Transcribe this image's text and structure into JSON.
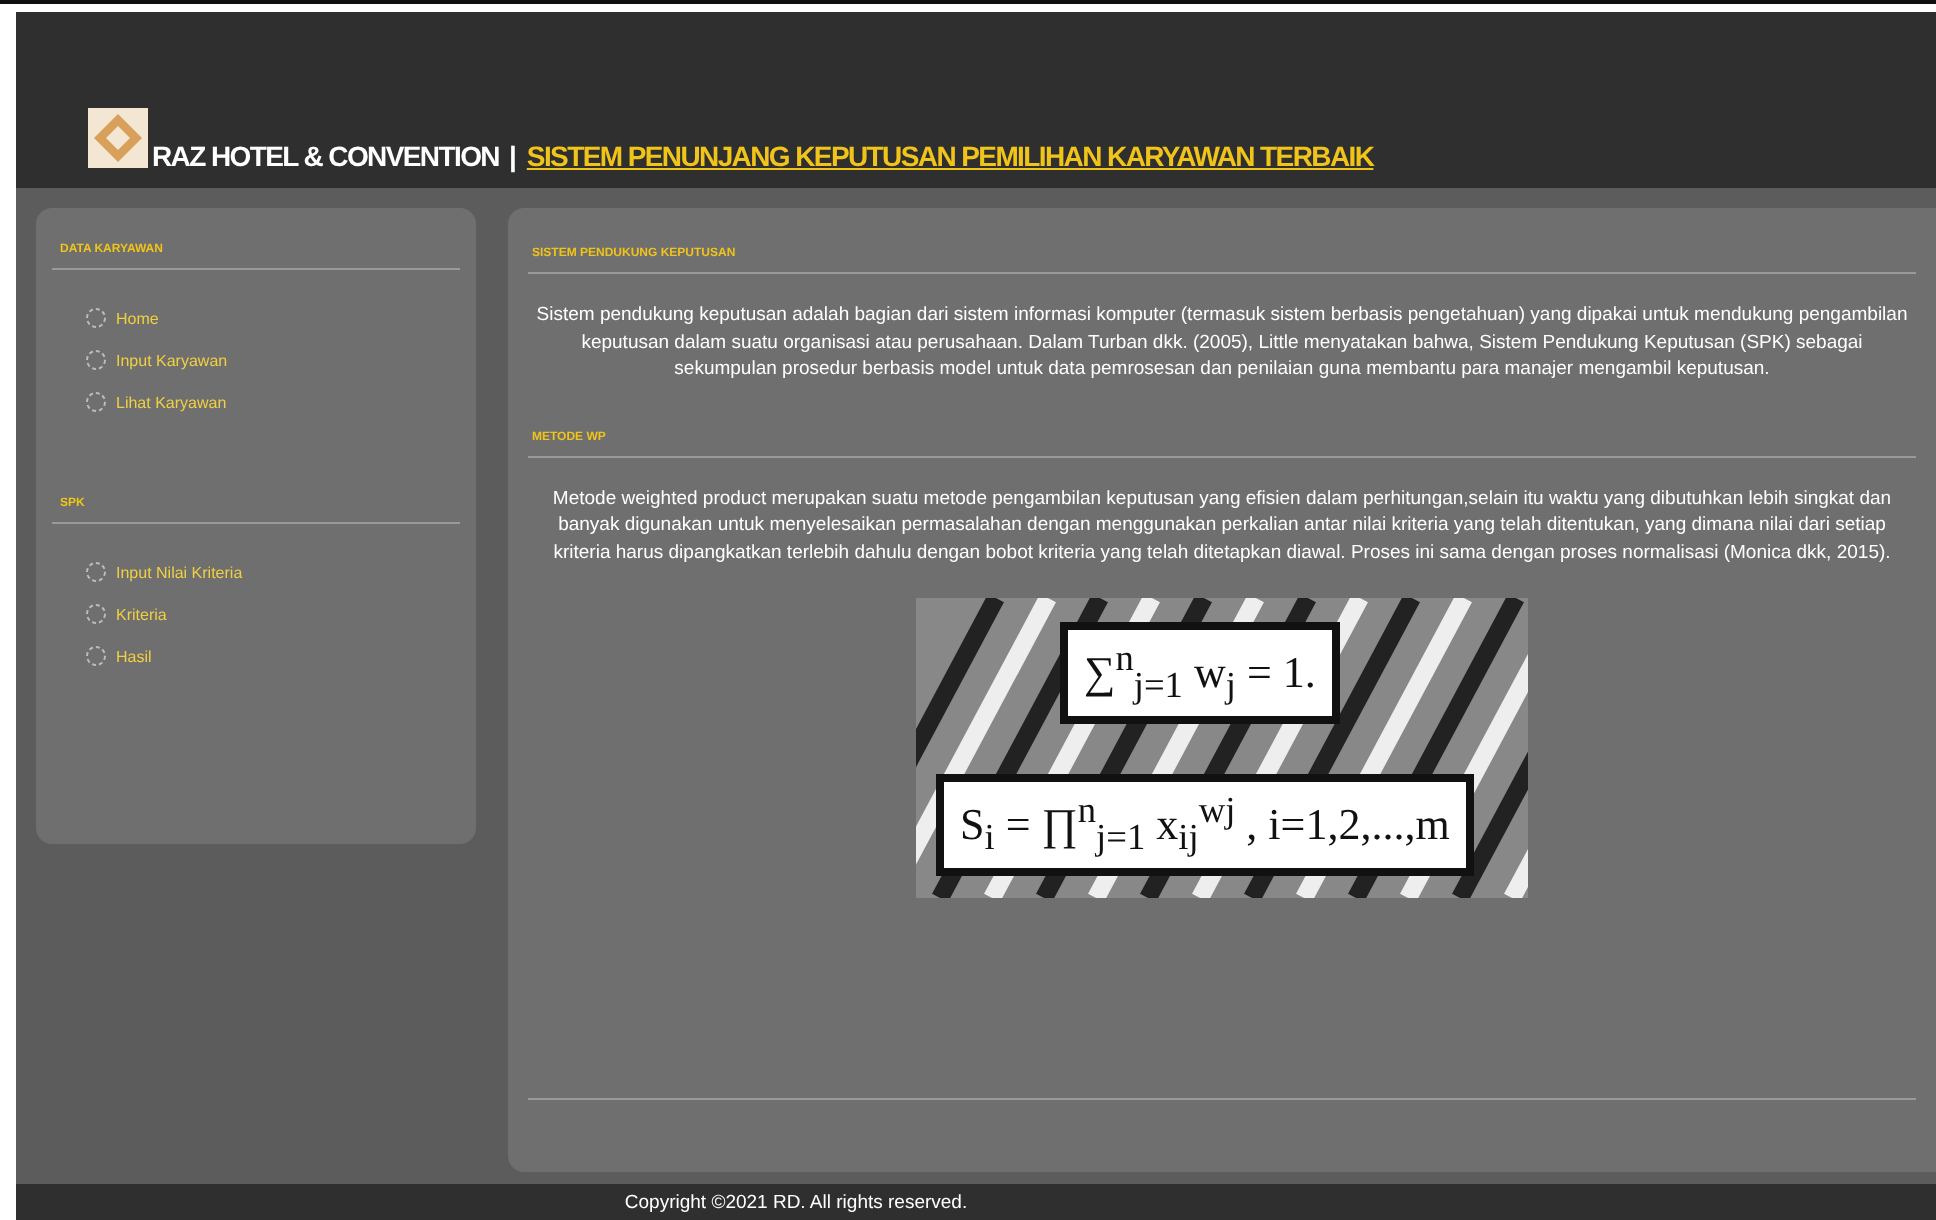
{
  "header": {
    "brand": "RAZ HOTEL & CONVENTION",
    "separator": "|",
    "title": "SISTEM PENUNJANG KEPUTUSAN PEMILIHAN KARYAWAN TERBAIK"
  },
  "sidebar": {
    "sections": [
      {
        "heading": "DATA KARYAWAN",
        "items": [
          {
            "label": "Home"
          },
          {
            "label": "Input Karyawan"
          },
          {
            "label": "Lihat Karyawan"
          }
        ]
      },
      {
        "heading": "SPK",
        "items": [
          {
            "label": "Input Nilai Kriteria"
          },
          {
            "label": "Kriteria"
          },
          {
            "label": "Hasil"
          }
        ]
      }
    ]
  },
  "content": {
    "sections": [
      {
        "heading": "SISTEM PENDUKUNG KEPUTUSAN",
        "text": "Sistem pendukung keputusan adalah bagian dari sistem informasi komputer (termasuk sistem berbasis pengetahuan) yang dipakai untuk mendukung pengambilan keputusan dalam suatu organisasi atau perusahaan. Dalam Turban dkk. (2005), Little menyatakan bahwa, Sistem Pendukung Keputusan (SPK) sebagai sekumpulan prosedur berbasis model untuk data pemrosesan dan penilaian guna membantu para manajer mengambil keputusan."
      },
      {
        "heading": "METODE WP",
        "text": "Metode weighted product merupakan suatu metode pengambilan keputusan yang efisien dalam perhitungan,selain itu waktu yang dibutuhkan lebih singkat dan banyak digunakan untuk menyelesaikan permasalahan dengan menggunakan perkalian antar nilai kriteria yang telah ditentukan, yang dimana nilai dari setiap kriteria harus dipangkatkan terlebih dahulu dengan bobot kriteria yang telah ditetapkan diawal. Proses ini sama dengan proses normalisasi (Monica dkk, 2015).",
        "formulas": [
          "∑$^{n}$$_{j=1}$ w$_{j}$ = 1.",
          "S$_{i}$ = ∏$^{n}$$_{j=1}$ x$_{ij}$$^{wj}$ , i=1,2,...,m"
        ]
      }
    ]
  },
  "footer": {
    "text": "Copyright ©2021 RD. All rights reserved."
  }
}
